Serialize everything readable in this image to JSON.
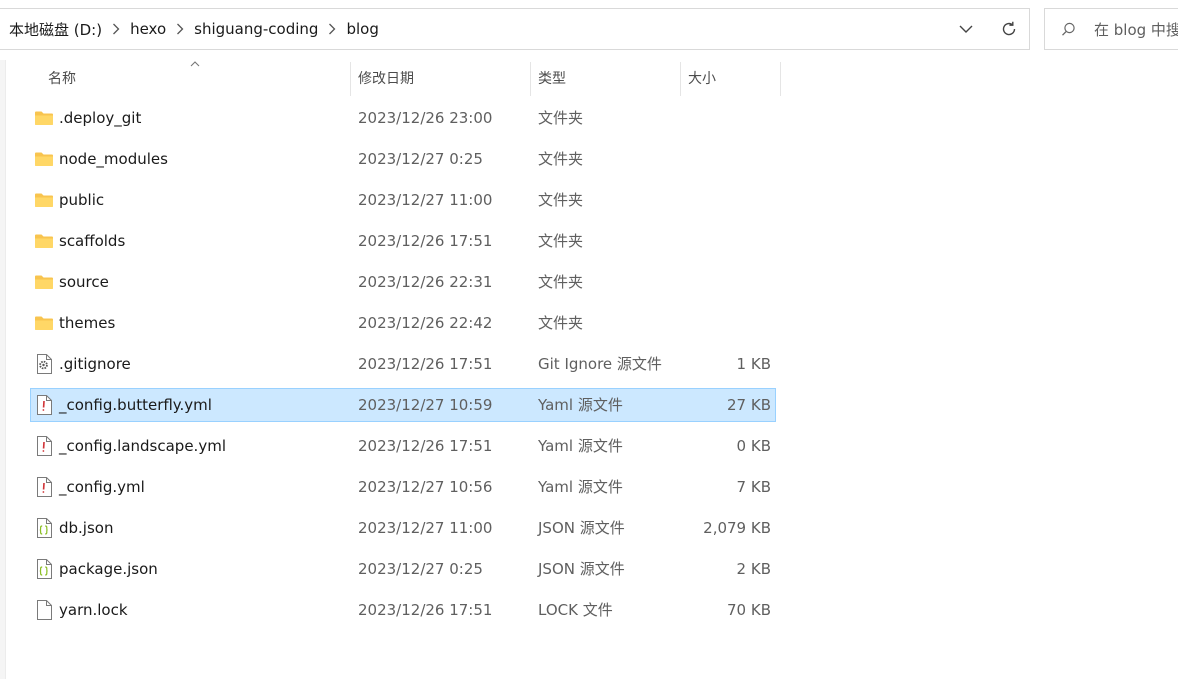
{
  "address_bar": {
    "crumbs": [
      "本地磁盘 (D:)",
      "hexo",
      "shiguang-coding",
      "blog"
    ]
  },
  "search": {
    "placeholder": "在 blog 中搜"
  },
  "columns": {
    "name": "名称",
    "date": "修改日期",
    "type": "类型",
    "size": "大小"
  },
  "files": [
    {
      "name": ".deploy_git",
      "date": "2023/12/26 23:00",
      "type": "文件夹",
      "size": "",
      "icon": "folder-icon"
    },
    {
      "name": "node_modules",
      "date": "2023/12/27 0:25",
      "type": "文件夹",
      "size": "",
      "icon": "folder-icon"
    },
    {
      "name": "public",
      "date": "2023/12/27 11:00",
      "type": "文件夹",
      "size": "",
      "icon": "folder-icon"
    },
    {
      "name": "scaffolds",
      "date": "2023/12/26 17:51",
      "type": "文件夹",
      "size": "",
      "icon": "folder-icon"
    },
    {
      "name": "source",
      "date": "2023/12/26 22:31",
      "type": "文件夹",
      "size": "",
      "icon": "folder-icon"
    },
    {
      "name": "themes",
      "date": "2023/12/26 22:42",
      "type": "文件夹",
      "size": "",
      "icon": "folder-icon"
    },
    {
      "name": ".gitignore",
      "date": "2023/12/26 17:51",
      "type": "Git Ignore 源文件",
      "size": "1 KB",
      "icon": "gear-file-icon"
    },
    {
      "name": "_config.butterfly.yml",
      "date": "2023/12/27 10:59",
      "type": "Yaml 源文件",
      "size": "27 KB",
      "icon": "yaml-file-icon"
    },
    {
      "name": "_config.landscape.yml",
      "date": "2023/12/26 17:51",
      "type": "Yaml 源文件",
      "size": "0 KB",
      "icon": "yaml-file-icon"
    },
    {
      "name": "_config.yml",
      "date": "2023/12/27 10:56",
      "type": "Yaml 源文件",
      "size": "7 KB",
      "icon": "yaml-file-icon"
    },
    {
      "name": "db.json",
      "date": "2023/12/27 11:00",
      "type": "JSON 源文件",
      "size": "2,079 KB",
      "icon": "json-file-icon"
    },
    {
      "name": "package.json",
      "date": "2023/12/27 0:25",
      "type": "JSON 源文件",
      "size": "2 KB",
      "icon": "json-file-icon"
    },
    {
      "name": "yarn.lock",
      "date": "2023/12/26 17:51",
      "type": "LOCK 文件",
      "size": "70 KB",
      "icon": "blank-file-icon"
    }
  ],
  "selected_file": "_config.butterfly.yml",
  "colors": {
    "selection_bg": "#cce8ff",
    "selection_border": "#99d1ff",
    "folder": "#f8c44f"
  }
}
